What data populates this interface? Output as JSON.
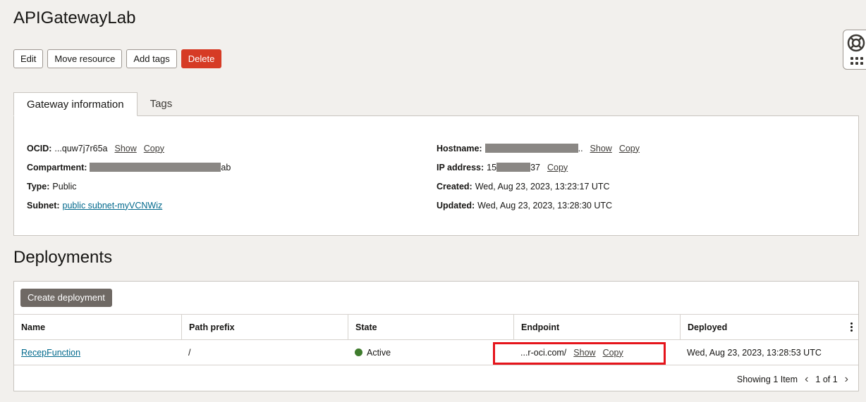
{
  "page": {
    "title": "APIGatewayLab"
  },
  "toolbar": {
    "edit": "Edit",
    "move": "Move resource",
    "add_tags": "Add tags",
    "delete": "Delete"
  },
  "tabs": [
    {
      "label": "Gateway information"
    },
    {
      "label": "Tags"
    }
  ],
  "info": {
    "ocid": {
      "label": "OCID:",
      "value": "...quw7j7r65a",
      "show": "Show",
      "copy": "Copy"
    },
    "compartment": {
      "label": "Compartment:",
      "value_suffix": "ab"
    },
    "type": {
      "label": "Type:",
      "value": "Public"
    },
    "subnet": {
      "label": "Subnet:",
      "value": "public subnet-myVCNWiz"
    },
    "hostname": {
      "label": "Hostname:",
      "value_suffix": "..",
      "show": "Show",
      "copy": "Copy"
    },
    "ip": {
      "label": "IP address:",
      "prefix": "15",
      "suffix": "37",
      "copy": "Copy"
    },
    "created": {
      "label": "Created:",
      "value": "Wed, Aug 23, 2023, 13:23:17 UTC"
    },
    "updated": {
      "label": "Updated:",
      "value": "Wed, Aug 23, 2023, 13:28:30 UTC"
    }
  },
  "deployments": {
    "title": "Deployments",
    "create_label": "Create deployment",
    "columns": [
      "Name",
      "Path prefix",
      "State",
      "Endpoint",
      "Deployed"
    ],
    "rows": [
      {
        "name": "RecepFunction",
        "path_prefix": "/",
        "state": "Active",
        "endpoint": "...r-oci.com/",
        "endpoint_show": "Show",
        "endpoint_copy": "Copy",
        "deployed": "Wed, Aug 23, 2023, 13:28:53 UTC"
      }
    ],
    "pager": {
      "showing": "Showing 1 Item",
      "page": "1 of 1"
    }
  },
  "colors": {
    "accent_danger": "#d63b25",
    "status_active": "#3f7c2d",
    "highlight": "#e5141b",
    "link": "#00688c"
  }
}
